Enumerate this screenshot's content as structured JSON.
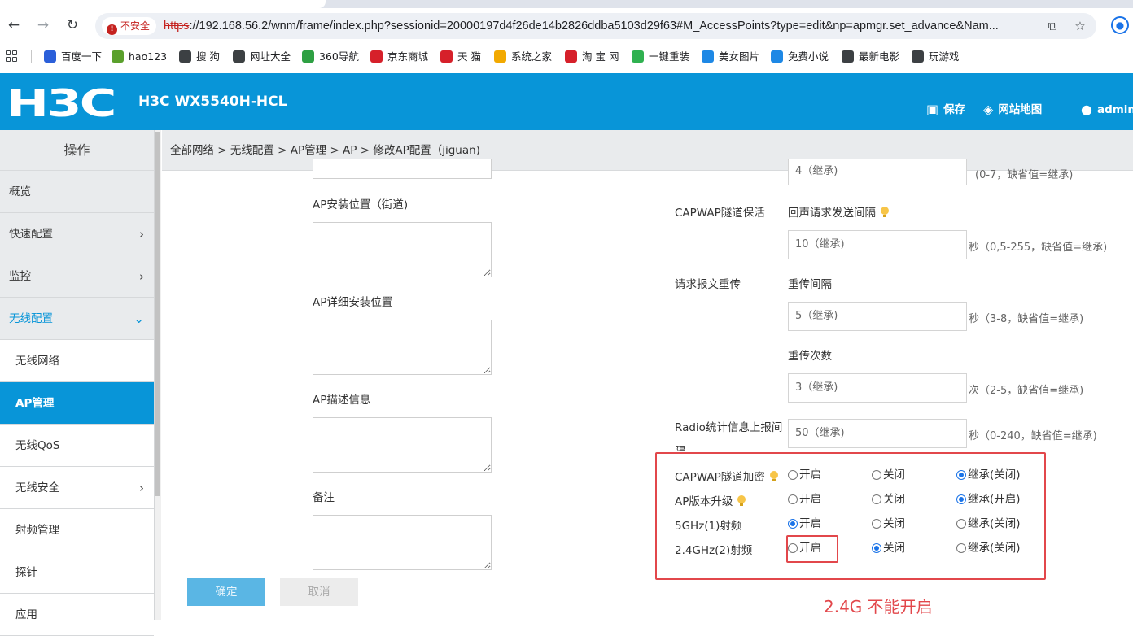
{
  "browser": {
    "insecure_label": "不安全",
    "url_scheme": "https",
    "url_rest": "://192.168.56.2/wnm/frame/index.php?sessionid=20000197d4f26de14b2826ddba5103d29f63#M_AccessPoints?type=edit&np=apmgr.set_advance&Nam...",
    "bookmarks": [
      {
        "label": "百度一下",
        "color": "#2b5fd9",
        "icon": "baidu-icon"
      },
      {
        "label": "hao123",
        "color": "#5aa02c",
        "icon": "hao123-icon"
      },
      {
        "label": "搜 狗",
        "color": "#3c4043",
        "icon": "globe-icon"
      },
      {
        "label": "网址大全",
        "color": "#3c4043",
        "icon": "globe-icon"
      },
      {
        "label": "360导航",
        "color": "#2ea043",
        "icon": "360-icon"
      },
      {
        "label": "京东商城",
        "color": "#d6202a",
        "icon": "jd-icon"
      },
      {
        "label": "天 猫",
        "color": "#d6202a",
        "icon": "jd-icon"
      },
      {
        "label": "系统之家",
        "color": "#f2a900",
        "icon": "windows-icon"
      },
      {
        "label": "淘 宝 网",
        "color": "#d6202a",
        "icon": "jd-icon"
      },
      {
        "label": "一键重装",
        "color": "#2fb150",
        "icon": "reinstall-icon"
      },
      {
        "label": "美女图片",
        "color": "#1e88e5",
        "icon": "ie-icon"
      },
      {
        "label": "免费小说",
        "color": "#1e88e5",
        "icon": "ie-icon"
      },
      {
        "label": "最新电影",
        "color": "#3c4043",
        "icon": "globe-icon"
      },
      {
        "label": "玩游戏",
        "color": "#3c4043",
        "icon": "globe-icon"
      }
    ]
  },
  "header": {
    "logo": "H3C",
    "device": "H3C WX5540H-HCL",
    "save": "保存",
    "sitemap": "网站地图",
    "user": "admin"
  },
  "sidebar": {
    "title": "操作",
    "items": [
      {
        "label": "概览",
        "chevron": ""
      },
      {
        "label": "快速配置",
        "chevron": "›"
      },
      {
        "label": "监控",
        "chevron": "›"
      },
      {
        "label": "无线配置",
        "chevron": "⌄"
      },
      {
        "label": "无线网络",
        "chevron": ""
      },
      {
        "label": "AP管理",
        "chevron": ""
      },
      {
        "label": "无线QoS",
        "chevron": ""
      },
      {
        "label": "无线安全",
        "chevron": "›"
      },
      {
        "label": "射频管理",
        "chevron": ""
      },
      {
        "label": "探针",
        "chevron": ""
      },
      {
        "label": "应用",
        "chevron": ""
      }
    ]
  },
  "breadcrumb": "全部网络 > 无线配置 > AP管理 > AP > 修改AP配置（jiguan)",
  "left_form": {
    "street_label": "AP安装位置（街道)",
    "detail_label": "AP详细安装位置",
    "desc_label": "AP描述信息",
    "remark_label": "备注",
    "ok": "确定",
    "cancel": "取消"
  },
  "right_form": {
    "top_value": "4（继承)",
    "top_hint": "(0-7，缺省值=继承)",
    "keepalive_label": "CAPWAP隧道保活",
    "echo_label": "回声请求发送间隔",
    "echo_value": "10（继承)",
    "echo_hint": "秒（0,5-255，缺省值=继承)",
    "retrans_label": "请求报文重传",
    "retrans_interval_label": "重传间隔",
    "retrans_interval_value": "5（继承)",
    "retrans_interval_hint": "秒（3-8，缺省值=继承)",
    "retrans_count_label": "重传次数",
    "retrans_count_value": "3（继承)",
    "retrans_count_hint": "次（2-5，缺省值=继承)",
    "radio_stats_label_1": "Radio统计信息上报间",
    "radio_stats_label_2": "隔",
    "radio_stats_value": "50（继承)",
    "radio_stats_hint": "秒（0-240，缺省值=继承)"
  },
  "radio_rows": [
    {
      "label": "CAPWAP隧道加密",
      "bulb": true,
      "options": [
        "开启",
        "关闭",
        "继承(关闭)"
      ],
      "selected": 2
    },
    {
      "label": "AP版本升级",
      "bulb": true,
      "options": [
        "开启",
        "关闭",
        "继承(开启)"
      ],
      "selected": 2
    },
    {
      "label": "5GHz(1)射频",
      "bulb": false,
      "options": [
        "开启",
        "关闭",
        "继承(关闭)"
      ],
      "selected": 0
    },
    {
      "label": "2.4GHz(2)射频",
      "bulb": false,
      "options": [
        "开启",
        "关闭",
        "继承(关闭)"
      ],
      "selected": 1
    }
  ],
  "annotation": "2.4G 不能开启"
}
